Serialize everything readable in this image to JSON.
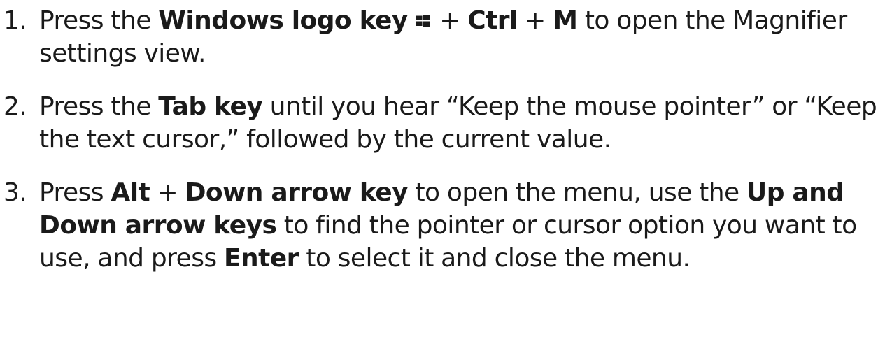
{
  "steps": [
    {
      "number": "1.",
      "text_a": "Press the ",
      "bold_windows_key": "Windows logo key",
      "icon": "windows-logo-icon",
      "text_plus_1": " + ",
      "bold_ctrl": "Ctrl",
      "text_plus_2": " + ",
      "bold_m": "M",
      "text_b": " to open the Magnifier settings view."
    },
    {
      "number": "2.",
      "text_a": "Press the ",
      "bold_tab_key": "Tab key",
      "text_b": " until you hear “Keep the mouse pointer” or “Keep the text cursor,” followed by the current value."
    },
    {
      "number": "3.",
      "text_a": "Press ",
      "bold_alt": "Alt",
      "text_plus": " + ",
      "bold_down_arrow_key": "Down arrow key",
      "text_b": " to open the menu, use the ",
      "bold_up_down_keys": "Up and Down arrow keys",
      "text_c": " to find the pointer or cursor option you want to use, and press ",
      "bold_enter": "Enter",
      "text_d": " to select it and close the menu."
    }
  ]
}
